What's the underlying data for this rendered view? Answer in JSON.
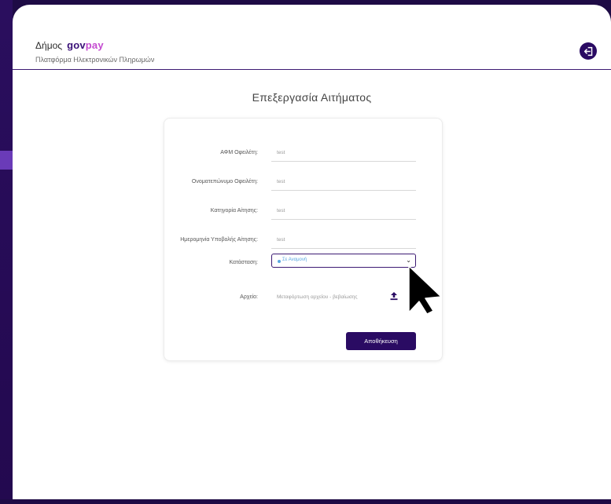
{
  "header": {
    "municipality": "Δήμος",
    "logo_gov": "gov",
    "logo_pay": "pay",
    "platform_name": "Πλατφόρμα Ηλεκτρονικών Πληρωμών"
  },
  "page_title": "Επεξεργασία Αιτήματος",
  "form": {
    "afm_label": "ΑΦΜ Οφειλέτη:",
    "afm_value": "test",
    "name_label": "Ονοματεπώνυμο Οφειλέτη:",
    "name_value": "test",
    "category_label": "Κατηγορία Αίτησης:",
    "category_value": "test",
    "date_label": "Ημερομηνία Υποβολής Αίτησης:",
    "date_value": "test",
    "status_label": "Κατάσταση:",
    "status_value": "Σε Αναμονή",
    "status_color": "#5ba8e0",
    "file_label": "Αρχείο:",
    "file_placeholder": "Μεταφόρτωση αρχείου - βεβαίωσης",
    "save_label": "Αποθήκευση"
  },
  "icons": {
    "logout": "logout-icon",
    "upload": "upload-icon",
    "chevron": "chevron-down-icon"
  },
  "colors": {
    "primary": "#2a0b63",
    "accent": "#c44bd0",
    "background": "#1e0b45"
  }
}
